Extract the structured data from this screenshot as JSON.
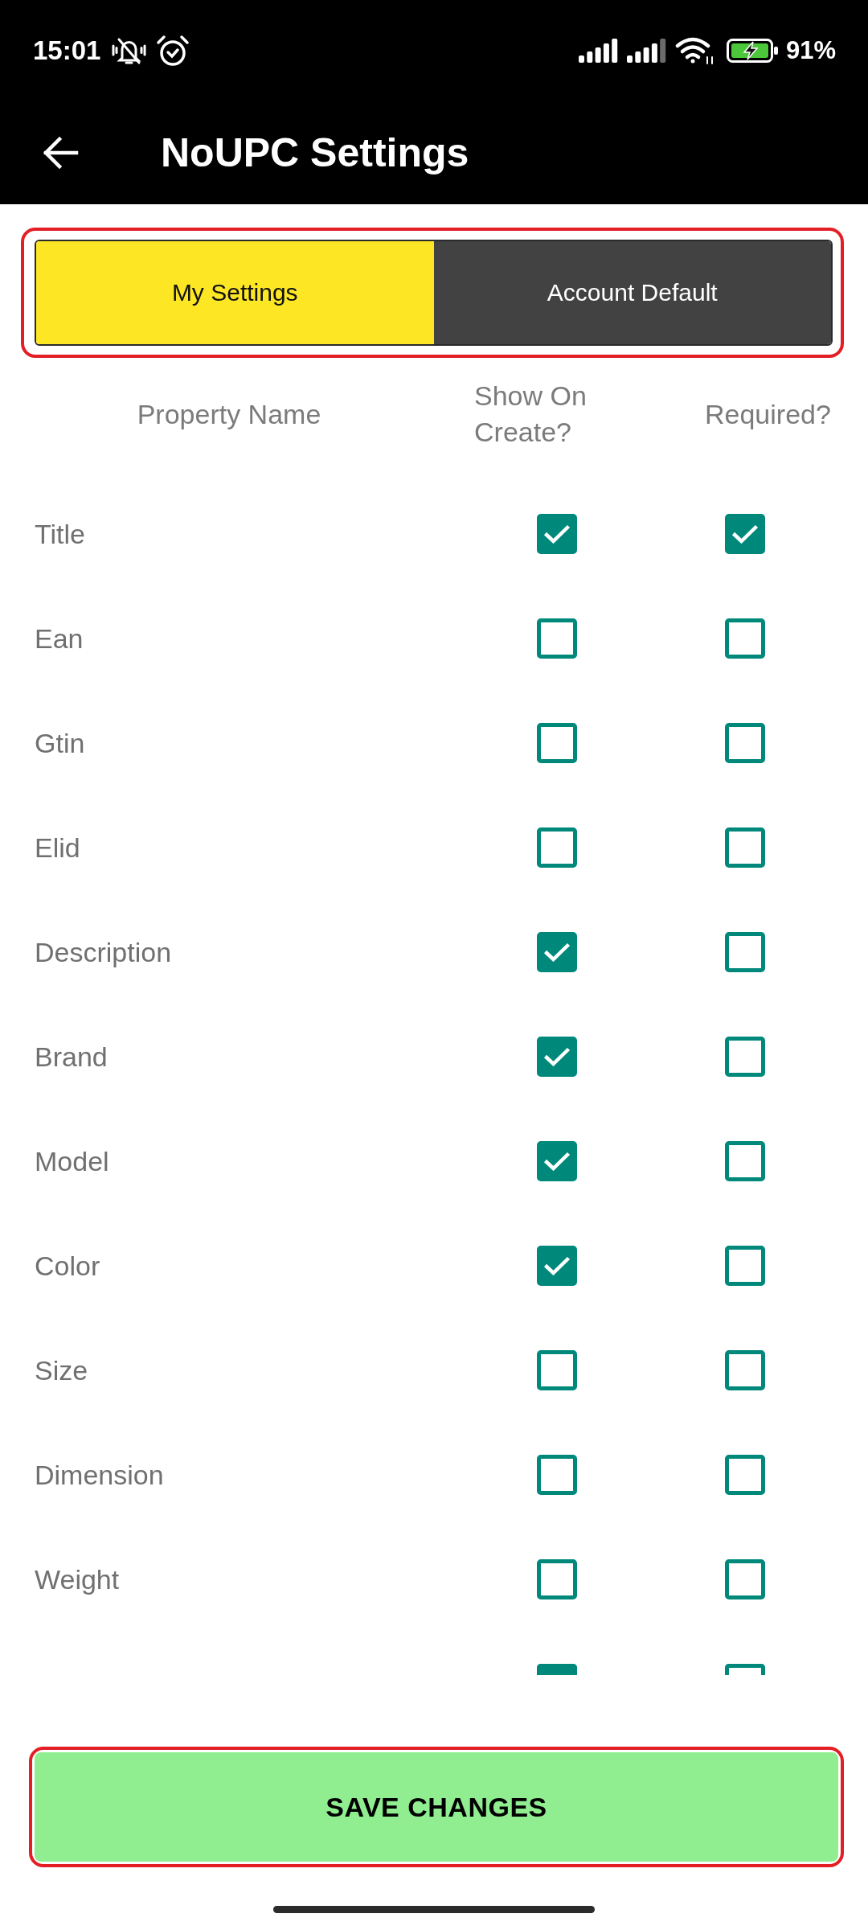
{
  "status_bar": {
    "time": "15:01",
    "battery": "91%"
  },
  "app_bar": {
    "title": "NoUPC Settings"
  },
  "tabs": {
    "highlighted": true,
    "items": [
      {
        "label": "My Settings",
        "selected": true
      },
      {
        "label": "Account Default",
        "selected": false
      }
    ]
  },
  "table": {
    "columns": [
      "Property Name",
      "Show On Create?",
      "Required?"
    ],
    "rows": [
      {
        "label": "Title",
        "show_on_create": true,
        "required": true
      },
      {
        "label": "Ean",
        "show_on_create": false,
        "required": false
      },
      {
        "label": "Gtin",
        "show_on_create": false,
        "required": false
      },
      {
        "label": "Elid",
        "show_on_create": false,
        "required": false
      },
      {
        "label": "Description",
        "show_on_create": true,
        "required": false
      },
      {
        "label": "Brand",
        "show_on_create": true,
        "required": false
      },
      {
        "label": "Model",
        "show_on_create": true,
        "required": false
      },
      {
        "label": "Color",
        "show_on_create": true,
        "required": false
      },
      {
        "label": "Size",
        "show_on_create": false,
        "required": false
      },
      {
        "label": "Dimension",
        "show_on_create": false,
        "required": false
      },
      {
        "label": "Weight",
        "show_on_create": false,
        "required": false
      },
      {
        "clipped": true,
        "show_on_create": true,
        "required": false
      }
    ]
  },
  "save_button": {
    "label": "SAVE CHANGES",
    "highlighted": true
  }
}
